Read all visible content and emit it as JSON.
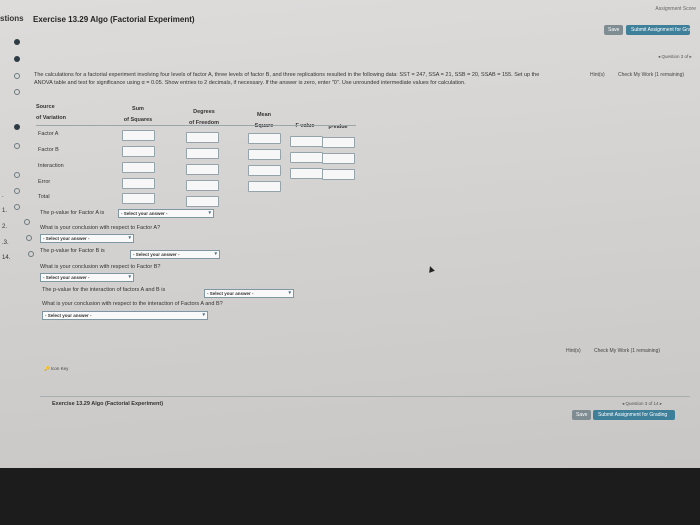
{
  "header": {
    "left_title": "stions",
    "exercise_title": "Exercise 13.29 Algo (Factorial Experiment)",
    "score_label": "Assignment Score",
    "save_label": "Save",
    "submit_label": "Submit Assignment for Grading"
  },
  "nav": {
    "question_nav": "◂ Question 3 of ▸",
    "hints_label": "Hint(s)",
    "check_label": "Check My Work (1 remaining)"
  },
  "sidebar": {
    "numbers": [
      ".",
      "1.",
      "2.",
      ".3.",
      "14."
    ]
  },
  "problem": {
    "line1": "The calculations for a factorial experiment involving four levels of factor A, three levels of factor B, and three replications resulted in the following data: SST = 247, SSA = 21, SSB = 20, SSAB = 155. Set up the",
    "line2": "ANOVA table and test for significance using α = 0.05. Show entries to 2 decimals, if necessary. If the answer is zero, enter \"0\". Use unrounded intermediate values for calculation."
  },
  "table": {
    "headers": {
      "source": "Source\nof Variation",
      "ss": "Sum\nof Squares",
      "df": "Degrees\nof Freedom",
      "ms": "Mean\nSquare",
      "f": "F value",
      "p": "p-value"
    },
    "rows": [
      "Factor A",
      "Factor B",
      "Interaction",
      "Error",
      "Total"
    ]
  },
  "questions": {
    "pA": "The p-value for Factor A is",
    "conclA": "What is your conclusion with respect to Factor A?",
    "pB": "The p-value for Factor B is",
    "conclB": "What is your conclusion with respect to Factor B?",
    "pAB": "The p-value for the interaction of factors A and B is",
    "conclAB": "What is your conclusion with respect to the interaction of Factors A and B?",
    "select_placeholder": "- Select your answer -"
  },
  "bottom": {
    "icon_key": "Icon Key",
    "hints_label": "Hint(s)",
    "check_label": "Check My Work (1 remaining)",
    "footer_title": "Exercise 13.29 Algo (Factorial Experiment)",
    "question_nav": "◂ Question 3 of 14 ▸",
    "save_label": "Save",
    "submit_label": "Submit Assignment for Grading"
  }
}
